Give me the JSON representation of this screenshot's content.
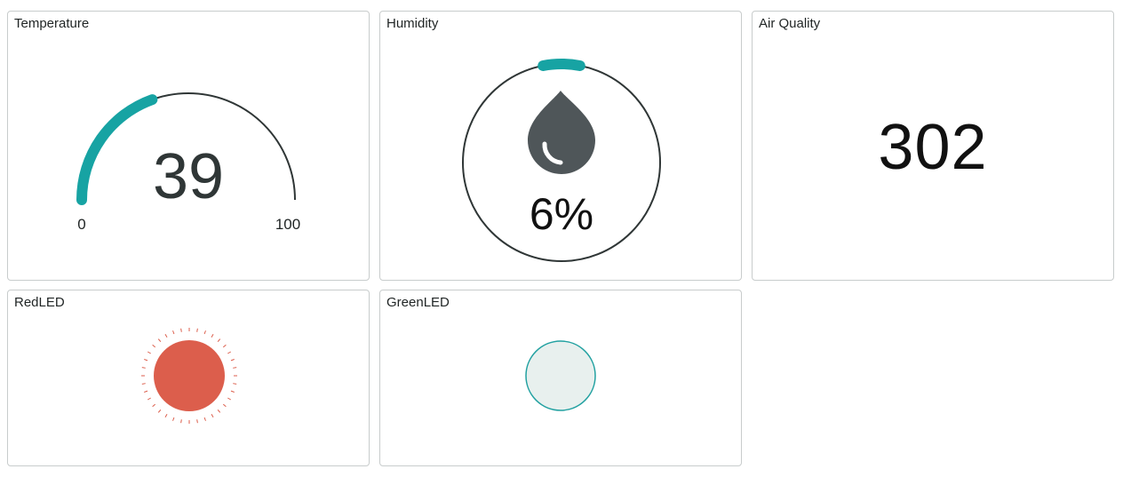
{
  "widgets": {
    "temperature": {
      "title": "Temperature",
      "value": 39,
      "value_text": "39",
      "min": 0,
      "max": 100,
      "min_text": "0",
      "max_text": "100"
    },
    "humidity": {
      "title": "Humidity",
      "value": 6,
      "value_text": "6%"
    },
    "air_quality": {
      "title": "Air Quality",
      "value_text": "302"
    },
    "red_led": {
      "title": "RedLED",
      "state": "on"
    },
    "green_led": {
      "title": "GreenLED",
      "state": "off"
    }
  },
  "colors": {
    "accent": "#17a3a3",
    "track": "#2f3636",
    "drop": "#4f5659",
    "red_led_on": "#dc5e4c",
    "green_led_off_fill": "#e8f0ee",
    "green_led_border": "#22a1a1",
    "card_border": "#c8cccc"
  },
  "icons": {
    "humidity": "water-drop-icon"
  }
}
